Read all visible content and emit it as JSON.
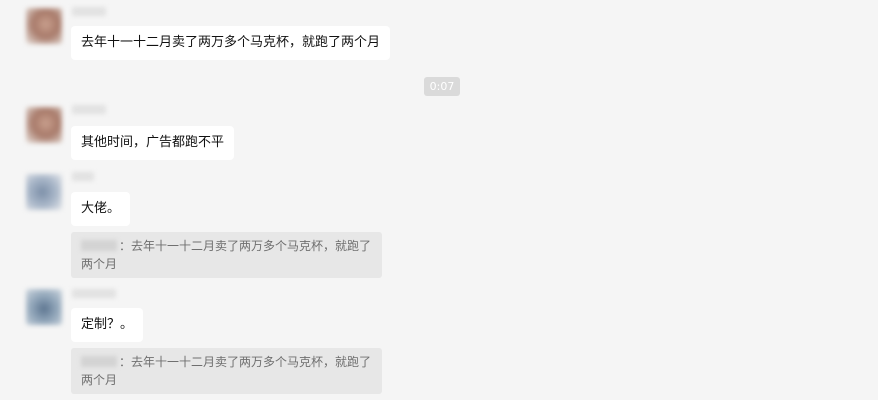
{
  "messages": [
    {
      "text": "去年十一十二月卖了两万多个马克杯，就跑了两个月"
    },
    {
      "text": "其他时间，广告都跑不平"
    },
    {
      "text": "大佬。",
      "quote": {
        "line1": "：去年十一十二月卖了两万多个马克杯，就跑了",
        "line2": "两个月"
      }
    },
    {
      "text": "定制？。",
      "quote": {
        "line1": "：去年十一十二月卖了两万多个马克杯，就跑了",
        "line2": "两个月"
      }
    }
  ],
  "timestamp": "0:07"
}
